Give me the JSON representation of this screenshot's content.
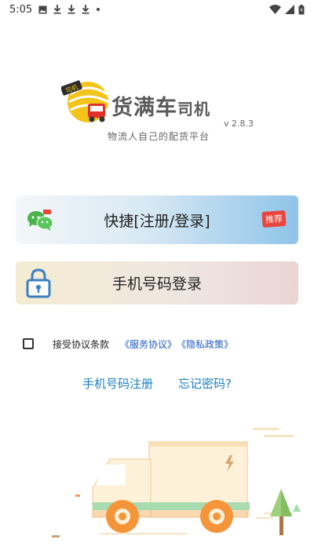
{
  "status_bar": {
    "time": "5:05",
    "icons": [
      "image-icon",
      "download-icon",
      "download-icon",
      "download-icon",
      "dot-icon"
    ],
    "right_icons": [
      "wifi-icon",
      "signal-icon",
      "battery-icon"
    ]
  },
  "brand": {
    "logo_badge": "司机",
    "title": "货满车",
    "title_suffix": "司机",
    "version": "v 2.8.3",
    "slogan": "物流人自己的配货平台"
  },
  "quick_login": {
    "label": "快捷[注册/登录]",
    "badge": "推荐",
    "icon": "wechat-icon"
  },
  "phone_login": {
    "label": "手机号码登录",
    "icon": "lock-icon"
  },
  "agreement": {
    "checked": false,
    "text": "接受协议条款",
    "service_link": "《服务协议》",
    "privacy_link": "《隐私政策》"
  },
  "links": {
    "register": "手机号码注册",
    "forgot": "忘记密码?"
  },
  "colors": {
    "link_blue": "#1a7fc4",
    "agreement_blue": "#1f58c7",
    "badge_red": "#e8453c",
    "truck_orange": "#f5953a"
  }
}
